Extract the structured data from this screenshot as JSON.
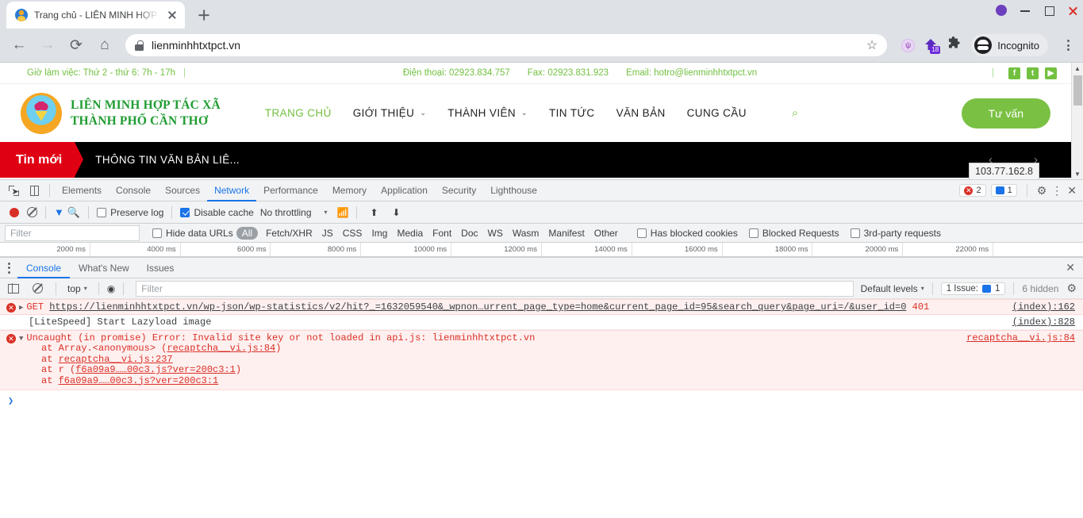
{
  "browser": {
    "tab_title": "Trang chủ - LIÊN MINH HỢP TÁC X",
    "new_tab_label": "+",
    "back_label": "←",
    "forward_label": "→",
    "reload_label": "⟳",
    "home_label": "⌂",
    "url": "lienminhhtxtpct.vn",
    "star_label": "☆",
    "extension_badge": "18",
    "puzzle_label": "🧩",
    "incognito_label": "Incognito",
    "min_label": "–",
    "max_label": "□",
    "close_label": "×"
  },
  "site": {
    "topbar": {
      "hours": "Giờ làm việc: Thứ 2 - thứ 6: 7h - 17h",
      "separator": "|",
      "phone": "Điện thoại: 02923.834.757",
      "fax": "Fax: 02923.831.923",
      "email": "Email: hotro@lienminhhtxtpct.vn",
      "social": [
        "f",
        "t",
        "▶"
      ]
    },
    "logo": {
      "line1": "LIÊN MINH HỢP TÁC XÃ",
      "line2": "THÀNH PHỐ CẦN THƠ"
    },
    "nav": [
      {
        "label": "TRANG CHỦ",
        "caret": "",
        "active": true
      },
      {
        "label": "GIỚI THIỆU",
        "caret": "⌄",
        "active": false
      },
      {
        "label": "THÀNH VIÊN",
        "caret": "⌄",
        "active": false
      },
      {
        "label": "TIN TỨC",
        "caret": "",
        "active": false
      },
      {
        "label": "VĂN BẢN",
        "caret": "",
        "active": false
      },
      {
        "label": "CUNG CẦU",
        "caret": "",
        "active": false
      }
    ],
    "search_icon": "⌕",
    "cta_label": "Tư vấn",
    "ticker": {
      "badge": "Tin mới",
      "headline": "THÔNG TIN VĂN BẢN LIÊ...",
      "prev": "‹",
      "next": "›"
    },
    "tooltip": "103.77.162.8",
    "scroll_up": "▲",
    "scroll_down": "▼"
  },
  "devtools": {
    "tabs": [
      "Elements",
      "Console",
      "Sources",
      "Network",
      "Performance",
      "Memory",
      "Application",
      "Security",
      "Lighthouse"
    ],
    "active_tab": "Network",
    "error_count": "2",
    "message_count": "1",
    "settings_icon": "⚙",
    "more_icon": "⋮",
    "close_icon": "✕",
    "network_toolbar": {
      "preserve_log": "Preserve log",
      "disable_cache": "Disable cache",
      "throttling": "No throttling",
      "throttle_caret": "▾",
      "import_icon": "⬆",
      "export_icon": "⬇"
    },
    "filter_bar": {
      "filter_placeholder": "Filter",
      "hide_data_urls": "Hide data URLs",
      "types": [
        "All",
        "Fetch/XHR",
        "JS",
        "CSS",
        "Img",
        "Media",
        "Font",
        "Doc",
        "WS",
        "Wasm",
        "Manifest",
        "Other"
      ],
      "has_blocked_cookies": "Has blocked cookies",
      "blocked_requests": "Blocked Requests",
      "third_party": "3rd-party requests"
    },
    "timeline_ticks": [
      "2000 ms",
      "4000 ms",
      "6000 ms",
      "8000 ms",
      "10000 ms",
      "12000 ms",
      "14000 ms",
      "16000 ms",
      "18000 ms",
      "20000 ms",
      "22000 ms",
      ""
    ],
    "drawer": {
      "tabs": [
        "Console",
        "What's New",
        "Issues"
      ],
      "active_tab": "Console",
      "console_toolbar": {
        "context": "top",
        "context_caret": "▾",
        "eye_icon": "◉",
        "filter_placeholder": "Filter",
        "levels": "Default levels",
        "levels_caret": "▾",
        "issue_label": "1 Issue:",
        "issue_count": "1",
        "hidden": "6 hidden"
      },
      "logs": [
        {
          "type": "error",
          "method": "GET",
          "url": "https://lienminhhtxtpct.vn/wp-json/wp-statistics/v2/hit?_=1632059540&_wpnon…urrent_page_type=home&current_page_id=95&search_query&page_uri=/&user_id=0",
          "status": "401",
          "source": "(index):162"
        },
        {
          "type": "info",
          "text": "[LiteSpeed] Start Lazyload image",
          "source": "(index):828"
        },
        {
          "type": "error",
          "text": "Uncaught (in promise) Error: Invalid site key or not loaded in api.js: lienminhhtxtpct.vn",
          "source": "recaptcha__vi.js:84",
          "stack": [
            "at Array.<anonymous> (recaptcha__vi.js:84)",
            "at recaptcha__vi.js:237",
            "at r (f6a09a9……00c3.js?ver=200c3:1)",
            "at f6a09a9……00c3.js?ver=200c3:1"
          ]
        }
      ],
      "prompt": "❯"
    }
  }
}
